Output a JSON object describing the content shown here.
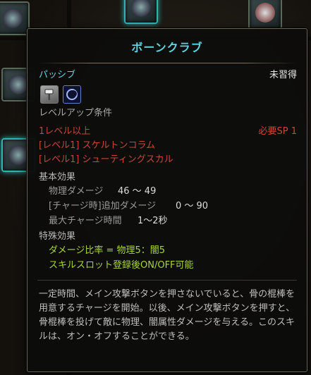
{
  "tooltip": {
    "title": "ボーンクラブ",
    "type_label": "パッシブ",
    "status": "未習得",
    "icons": [
      "hammer-icon",
      "crescent-moon-icon"
    ],
    "level_up_title": "レベルアップ条件",
    "requirements": [
      "1レベル以上",
      "[レベル1] スケルトンコラム",
      "[レベル1] シューティングスカル"
    ],
    "required_sp": "必要SP 1",
    "base_effect_title": "基本効果",
    "stats": [
      {
        "label": "物理ダメージ",
        "value": "46 ～ 49"
      },
      {
        "label": "[チャージ時]追加ダメージ",
        "value": "0 ～ 90"
      },
      {
        "label": "最大チャージ時間",
        "value": "1～2秒"
      }
    ],
    "special_effect_title": "特殊効果",
    "special_effects": [
      "ダメージ比率 = 物理5：闇5",
      "スキルスロット登録後ON/OFF可能"
    ],
    "description": "一定時間、メイン攻撃ボタンを押さないでいると、骨の棍棒を用意するチャージを開始。以後、メイン攻撃ボタンを押すと、骨棍棒を投げて敵に物理、闇属性ダメージを与える。このスキルは、オン・オフすることができる。"
  },
  "colors": {
    "title": "#5fd3e0",
    "requirement": "#c5483a",
    "special": "#a7d63a"
  }
}
